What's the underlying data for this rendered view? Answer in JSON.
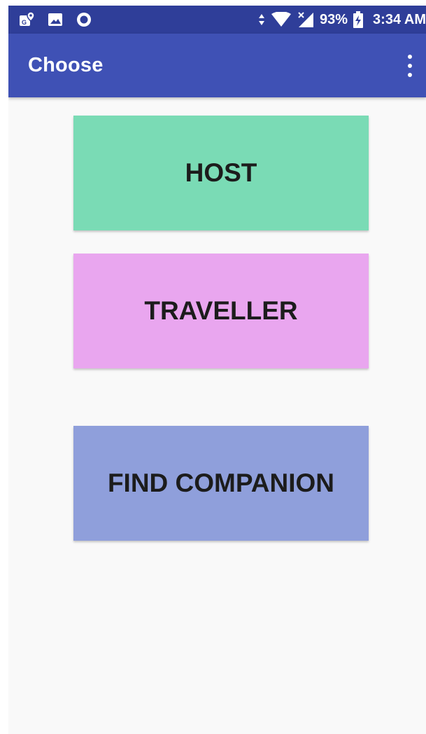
{
  "status_bar": {
    "icons_left": [
      "maps-notification-icon",
      "image-notification-icon",
      "circle-notification-icon"
    ],
    "icons_right": [
      "data-arrows-icon",
      "wifi-icon",
      "signal-icon",
      "battery-charging-icon"
    ],
    "battery": "93%",
    "time": "3:34 AM"
  },
  "app_bar": {
    "title": "Choose",
    "menu_icon": "more-vert-icon"
  },
  "buttons": {
    "host": {
      "label": "HOST",
      "color": "#7adbb5"
    },
    "traveller": {
      "label": "TRAVELLER",
      "color": "#e9a6ef"
    },
    "find_companion": {
      "label": "FIND COMPANION",
      "color": "#8f9fdb"
    }
  },
  "colors": {
    "status_bar": "#2f3e99",
    "app_bar": "#3f51b5",
    "background": "#f9f9f9"
  }
}
